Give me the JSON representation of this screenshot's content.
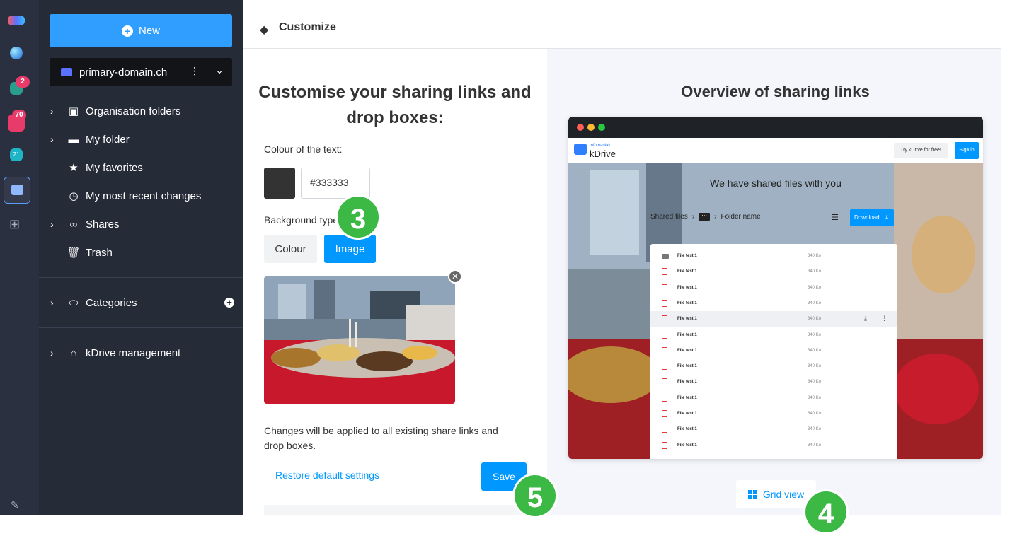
{
  "sidebar": {
    "new_label": "New",
    "domain": "primary-domain.ch",
    "items": [
      {
        "label": "Organisation folders"
      },
      {
        "label": "My folder"
      },
      {
        "label": "My favorites"
      },
      {
        "label": "My most recent changes"
      },
      {
        "label": "Shares"
      },
      {
        "label": "Trash"
      },
      {
        "label": "Categories"
      },
      {
        "label": "kDrive management"
      }
    ]
  },
  "rail": {
    "badges": [
      "2",
      "70",
      "21"
    ]
  },
  "header": {
    "title": "Customize"
  },
  "customise": {
    "heading": "Customise your sharing links and drop boxes:",
    "text_colour_label": "Colour of the text:",
    "text_colour_value": "#333333",
    "background_type_label": "Background type",
    "option_colour": "Colour",
    "option_image": "Image",
    "selected_option": "Image",
    "note": "Changes will be applied to all existing share links and drop boxes.",
    "restore_label": "Restore default settings",
    "save_label": "Save"
  },
  "overview": {
    "heading": "Overview of sharing links",
    "preview": {
      "brand_small": "Infomaniak",
      "brand": "kDrive",
      "try_label": "Try kDrive for free!",
      "signin_label": "Sign in",
      "shared_title": "We have shared files with you",
      "crumb_root": "Shared files",
      "crumb_folder": "Folder name",
      "download_label": "Download",
      "files": [
        {
          "name": "File test 1",
          "size": "340 Ko",
          "kind": "folder"
        },
        {
          "name": "File test 1",
          "size": "340 Ko",
          "kind": "pdf"
        },
        {
          "name": "File test 1",
          "size": "340 Ko",
          "kind": "pdf"
        },
        {
          "name": "File test 1",
          "size": "340 Ko",
          "kind": "pdf"
        },
        {
          "name": "File test 1",
          "size": "340 Ko",
          "kind": "pdf"
        },
        {
          "name": "File test 1",
          "size": "340 Ko",
          "kind": "pdf"
        },
        {
          "name": "File test 1",
          "size": "340 Ko",
          "kind": "pdf"
        },
        {
          "name": "File test 1",
          "size": "340 Ko",
          "kind": "pdf"
        },
        {
          "name": "File test 1",
          "size": "340 Ko",
          "kind": "pdf"
        },
        {
          "name": "File test 1",
          "size": "340 Ko",
          "kind": "pdf"
        },
        {
          "name": "File test 1",
          "size": "340 Ko",
          "kind": "pdf"
        },
        {
          "name": "File test 1",
          "size": "340 Ko",
          "kind": "pdf"
        },
        {
          "name": "File test 1",
          "size": "340 Ko",
          "kind": "pdf"
        }
      ]
    },
    "grid_view_label": "Grid view"
  },
  "steps": [
    "3",
    "4",
    "5"
  ],
  "colors": {
    "accent": "#0098ff",
    "sidebar_bg": "#262b38",
    "rail_bg": "#2b3040",
    "step_green": "#3cb944"
  }
}
